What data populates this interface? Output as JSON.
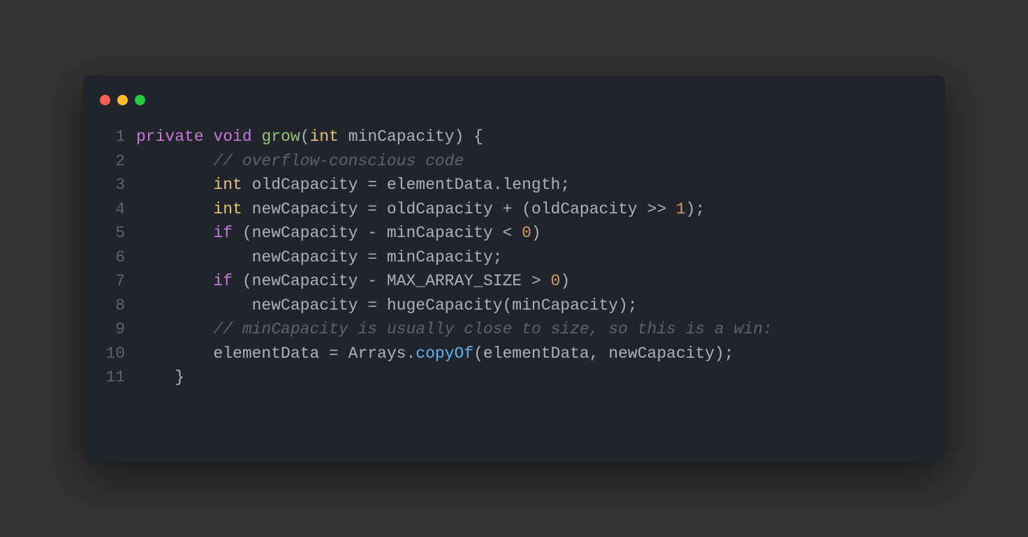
{
  "window": {
    "dots": [
      "close",
      "minimize",
      "zoom"
    ]
  },
  "code": {
    "lines": [
      {
        "num": "1",
        "tokens": [
          {
            "t": "private",
            "c": "c-keyword"
          },
          {
            "t": " ",
            "c": "c-fg"
          },
          {
            "t": "void",
            "c": "c-keyword"
          },
          {
            "t": " ",
            "c": "c-fg"
          },
          {
            "t": "grow",
            "c": "c-func"
          },
          {
            "t": "(",
            "c": "c-fg"
          },
          {
            "t": "int",
            "c": "c-type"
          },
          {
            "t": " minCapacity) {",
            "c": "c-fg"
          }
        ]
      },
      {
        "num": "2",
        "tokens": [
          {
            "t": "        ",
            "c": "c-fg"
          },
          {
            "t": "// overflow-conscious code",
            "c": "c-comment"
          }
        ]
      },
      {
        "num": "3",
        "tokens": [
          {
            "t": "        ",
            "c": "c-fg"
          },
          {
            "t": "int",
            "c": "c-type"
          },
          {
            "t": " oldCapacity = elementData.length;",
            "c": "c-fg"
          }
        ]
      },
      {
        "num": "4",
        "tokens": [
          {
            "t": "        ",
            "c": "c-fg"
          },
          {
            "t": "int",
            "c": "c-type"
          },
          {
            "t": " newCapacity = oldCapacity + (oldCapacity >> ",
            "c": "c-fg"
          },
          {
            "t": "1",
            "c": "c-num"
          },
          {
            "t": ");",
            "c": "c-fg"
          }
        ]
      },
      {
        "num": "5",
        "tokens": [
          {
            "t": "        ",
            "c": "c-fg"
          },
          {
            "t": "if",
            "c": "c-keyword"
          },
          {
            "t": " (newCapacity - minCapacity < ",
            "c": "c-fg"
          },
          {
            "t": "0",
            "c": "c-num"
          },
          {
            "t": ")",
            "c": "c-fg"
          }
        ]
      },
      {
        "num": "6",
        "tokens": [
          {
            "t": "            newCapacity = minCapacity;",
            "c": "c-fg"
          }
        ]
      },
      {
        "num": "7",
        "tokens": [
          {
            "t": "        ",
            "c": "c-fg"
          },
          {
            "t": "if",
            "c": "c-keyword"
          },
          {
            "t": " (newCapacity - MAX_ARRAY_SIZE > ",
            "c": "c-fg"
          },
          {
            "t": "0",
            "c": "c-num"
          },
          {
            "t": ")",
            "c": "c-fg"
          }
        ]
      },
      {
        "num": "8",
        "tokens": [
          {
            "t": "            newCapacity = hugeCapacity(minCapacity);",
            "c": "c-fg"
          }
        ]
      },
      {
        "num": "9",
        "tokens": [
          {
            "t": "        ",
            "c": "c-fg"
          },
          {
            "t": "// minCapacity is usually close to size, so this is a win:",
            "c": "c-comment"
          }
        ]
      },
      {
        "num": "10",
        "tokens": [
          {
            "t": "        elementData = Arrays.",
            "c": "c-fg"
          },
          {
            "t": "copyOf",
            "c": "c-builtin"
          },
          {
            "t": "(elementData, newCapacity);",
            "c": "c-fg"
          }
        ]
      },
      {
        "num": "11",
        "tokens": [
          {
            "t": "    }",
            "c": "c-fg"
          }
        ]
      }
    ]
  }
}
